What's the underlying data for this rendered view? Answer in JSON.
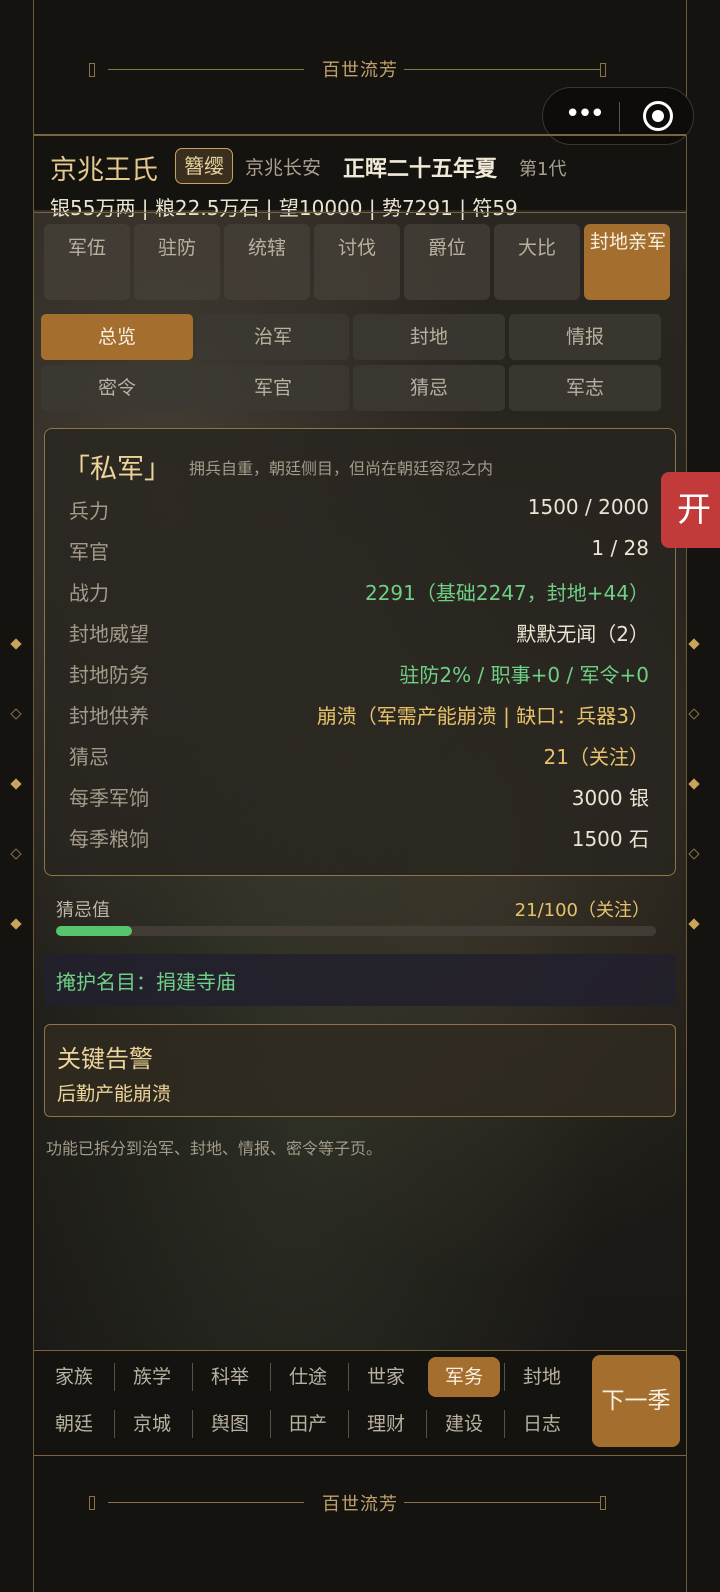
{
  "app": {
    "banner_title": "百世流芳",
    "footer_banner_title": "百世流芳"
  },
  "header": {
    "family_name": "京兆王氏",
    "rank": "簪缨",
    "location": "京兆长安",
    "era": "正晖二十五年夏",
    "generation": "第1代",
    "resources": "银55万两 | 粮22.5万石 | 望10000 | 势7291 | 符59"
  },
  "main_tabs": [
    {
      "label": "军伍"
    },
    {
      "label": "驻防"
    },
    {
      "label": "统辖"
    },
    {
      "label": "讨伐"
    },
    {
      "label": "爵位"
    },
    {
      "label": "大比"
    },
    {
      "label": "封地亲军",
      "active": true
    }
  ],
  "sub_tabs": [
    {
      "label": "总览",
      "active": true
    },
    {
      "label": "治军"
    },
    {
      "label": "封地"
    },
    {
      "label": "情报"
    },
    {
      "label": "密令"
    },
    {
      "label": "军官"
    },
    {
      "label": "猜忌"
    },
    {
      "label": "军志"
    }
  ],
  "panel": {
    "title": "「私军」",
    "description": "拥兵自重，朝廷侧目，但尚在朝廷容忍之内",
    "stats": [
      {
        "label": "兵力",
        "value": "1500 / 2000",
        "tone": "white"
      },
      {
        "label": "军官",
        "value": "1 / 28",
        "tone": "white"
      },
      {
        "label": "战力",
        "value": "2291（基础2247，封地+44）",
        "tone": "green"
      },
      {
        "label": "封地威望",
        "value": "默默无闻（2）",
        "tone": "white"
      },
      {
        "label": "封地防务",
        "value": "驻防2% / 职事+0 / 军令+0",
        "tone": "green"
      },
      {
        "label": "封地供养",
        "value": "崩溃（军需产能崩溃 | 缺口：兵器3）",
        "tone": "gold"
      },
      {
        "label": "猜忌",
        "value": "21（关注）",
        "tone": "gold"
      },
      {
        "label": "每季军饷",
        "value": "3000 银",
        "tone": "white"
      },
      {
        "label": "每季粮饷",
        "value": "1500 石",
        "tone": "white"
      }
    ]
  },
  "suspicion": {
    "label": "猜忌值",
    "value_text": "21/100（关注）",
    "fraction": 0.21
  },
  "cover": {
    "text": "掩护名目：捐建寺庙"
  },
  "alert": {
    "title": "关键告警",
    "text": "后勤产能崩溃"
  },
  "footnote": "功能已拆分到治军、封地、情报、密令等子页。",
  "side_tab": "开",
  "bottom_nav": {
    "row1": [
      {
        "label": "家族"
      },
      {
        "label": "族学"
      },
      {
        "label": "科举"
      },
      {
        "label": "仕途"
      },
      {
        "label": "世家"
      },
      {
        "label": "军务",
        "active": true
      },
      {
        "label": "封地"
      }
    ],
    "row2": [
      {
        "label": "朝廷"
      },
      {
        "label": "京城"
      },
      {
        "label": "舆图"
      },
      {
        "label": "田产"
      },
      {
        "label": "理财"
      },
      {
        "label": "建设"
      },
      {
        "label": "日志"
      }
    ],
    "next_label": "下一季"
  },
  "colors": {
    "accent": "#a46f2e",
    "gold_text": "#e6c36b",
    "green_text": "#6fcf85",
    "alert_red": "#c23a3a"
  }
}
